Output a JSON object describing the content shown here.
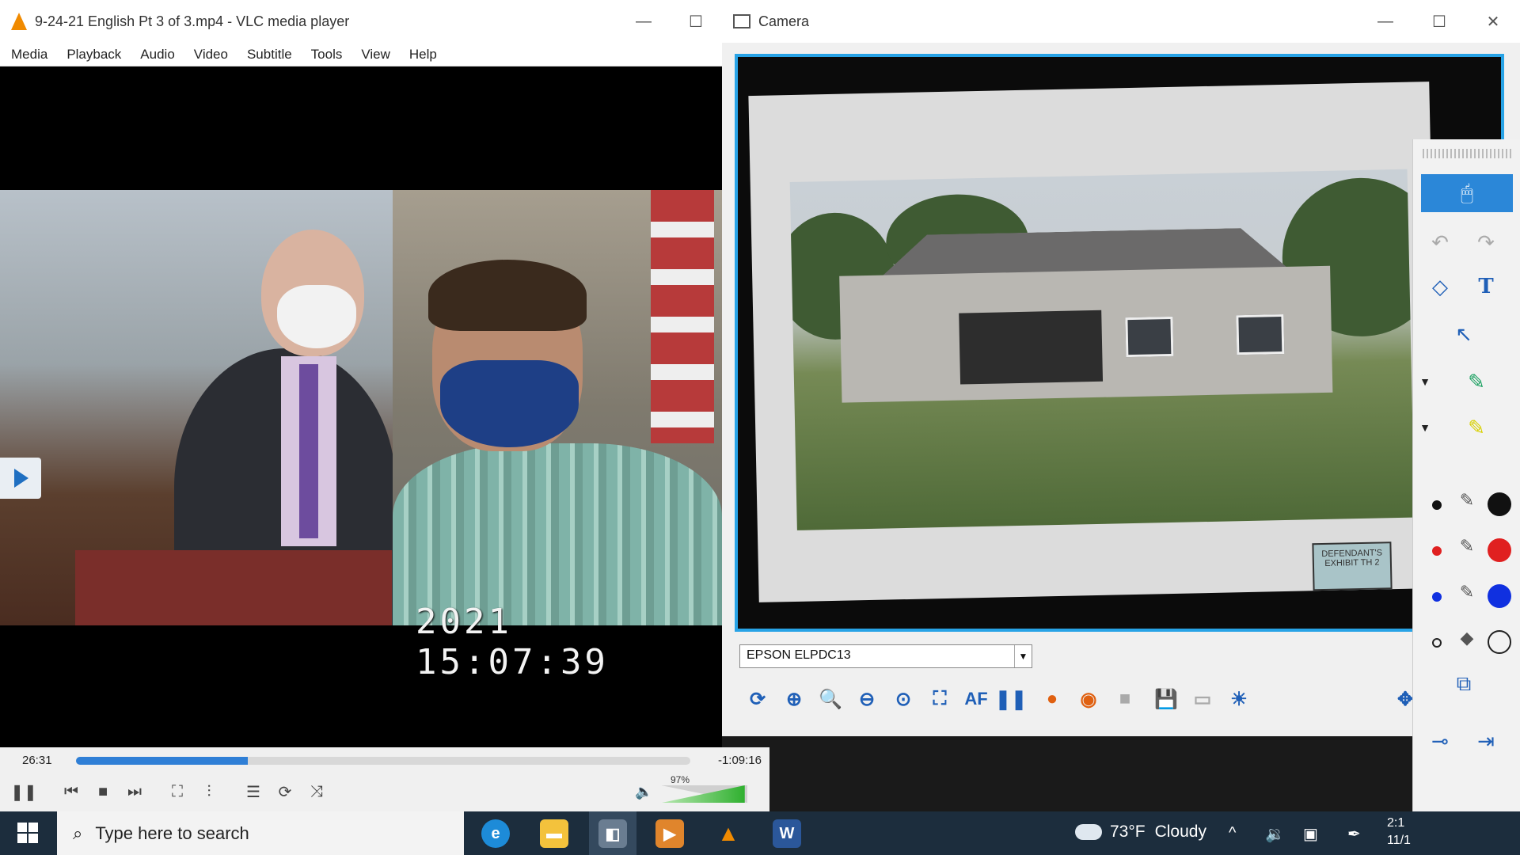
{
  "vlc": {
    "title": "9-24-21 English Pt 3 of 3.mp4 - VLC media player",
    "menu": [
      "Media",
      "Playback",
      "Audio",
      "Video",
      "Subtitle",
      "Tools",
      "View",
      "Help"
    ],
    "timestamp_overlay": "2021  15:07:39",
    "elapsed": "26:31",
    "remaining": "-1:09:16",
    "progress": 0.28,
    "volume_label": "97%",
    "volume": 0.97
  },
  "camera": {
    "title": "Camera",
    "device": "EPSON ELPDC13",
    "autofocus_label": "AF",
    "exhibit_label": "DEFENDANT'S EXHIBIT TH 2"
  },
  "annotation": {
    "text_tool_label": "T"
  },
  "taskbar": {
    "search_placeholder": "Type here to search",
    "weather_temp": "73°F",
    "weather_text": "Cloudy",
    "clock_time": "2:1",
    "clock_date": "11/1"
  },
  "colors": {
    "accent": "#28a3e6",
    "seek": "#2f7fd6",
    "pen_black": "#111111",
    "pen_red": "#e02020",
    "pen_blue": "#1030e0"
  }
}
